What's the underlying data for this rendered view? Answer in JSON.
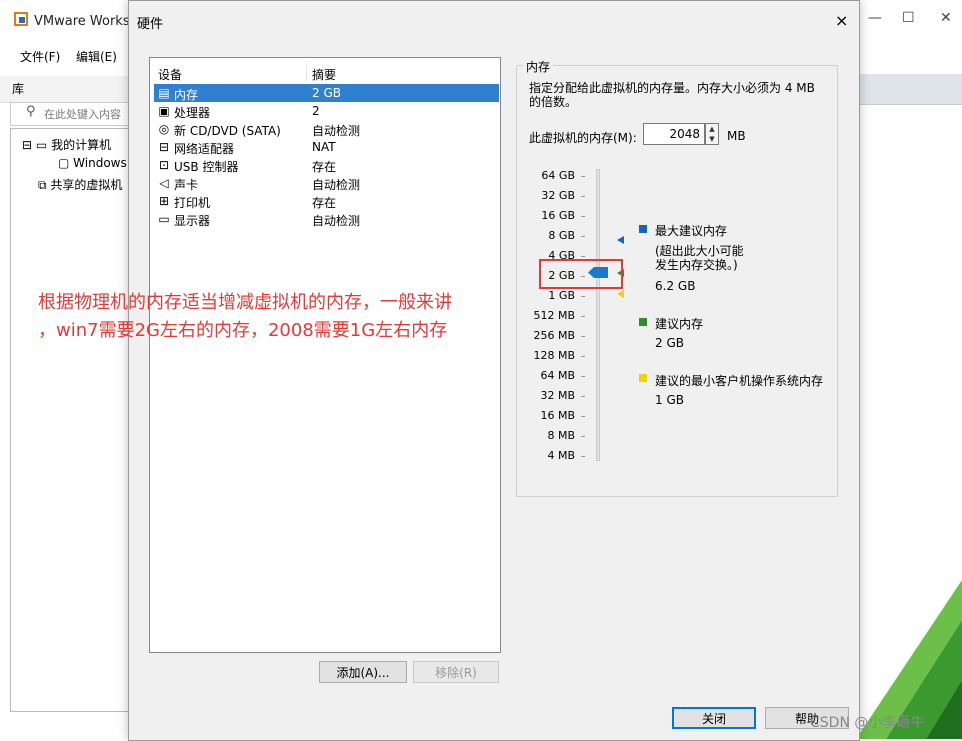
{
  "background_app": {
    "title": "VMware Works",
    "menus": [
      "文件(F)",
      "编辑(E)"
    ],
    "library_label": "库",
    "search_placeholder": "在此处键入内容",
    "tree": [
      "我的计算机",
      "Windows",
      "共享的虚拟机"
    ]
  },
  "dialog": {
    "title": "硬件",
    "close_glyph": "×",
    "device_list": {
      "header_device": "设备",
      "header_summary": "摘要",
      "items": [
        {
          "icon": "memory-icon",
          "glyph": "▤",
          "name": "内存",
          "summary": "2 GB",
          "selected": true
        },
        {
          "icon": "processor-icon",
          "glyph": "▣",
          "name": "处理器",
          "summary": "2"
        },
        {
          "icon": "cd-dvd-icon",
          "glyph": "◎",
          "name": "新 CD/DVD (SATA)",
          "summary": "自动检测"
        },
        {
          "icon": "network-adapter-icon",
          "glyph": "⊟",
          "name": "网络适配器",
          "summary": "NAT"
        },
        {
          "icon": "usb-controller-icon",
          "glyph": "⊡",
          "name": "USB 控制器",
          "summary": "存在"
        },
        {
          "icon": "sound-card-icon",
          "glyph": "◁",
          "name": "声卡",
          "summary": "自动检测"
        },
        {
          "icon": "printer-icon",
          "glyph": "⊞",
          "name": "打印机",
          "summary": "存在"
        },
        {
          "icon": "display-icon",
          "glyph": "▭",
          "name": "显示器",
          "summary": "自动检测"
        }
      ]
    },
    "buttons": {
      "add": "添加(A)...",
      "remove": "移除(R)",
      "close": "关闭",
      "help": "帮助"
    },
    "memory": {
      "group_label": "内存",
      "description": "指定分配给此虚拟机的内存量。内存大小必须为 4 MB 的倍数。",
      "field_label": "此虚拟机的内存(M):",
      "value": "2048",
      "unit": "MB",
      "scale": [
        "64 GB",
        "32 GB",
        "16 GB",
        "8 GB",
        "4 GB",
        "2 GB",
        "1 GB",
        "512 MB",
        "256 MB",
        "128 MB",
        "64 MB",
        "32 MB",
        "16 MB",
        "8 MB",
        "4 MB"
      ],
      "legend": [
        {
          "color": "#1565c0",
          "label": "最大建议内存",
          "note": "(超出此大小可能\n发生内存交换。)",
          "value": "6.2 GB"
        },
        {
          "color": "#2e8b2e",
          "label": "建议内存",
          "value": "2 GB"
        },
        {
          "color": "#f5d000",
          "label": "建议的最小客户机操作系统内存",
          "value": "1 GB"
        }
      ]
    }
  },
  "annotation": {
    "line1": "根据物理机的内存适当增减虚拟机的内存，一般来讲",
    "line2": "，win7需要2G左右的内存，2008需要1G左右内存",
    "color": "#e53935"
  },
  "watermark": "CSDN @小李砸牛"
}
